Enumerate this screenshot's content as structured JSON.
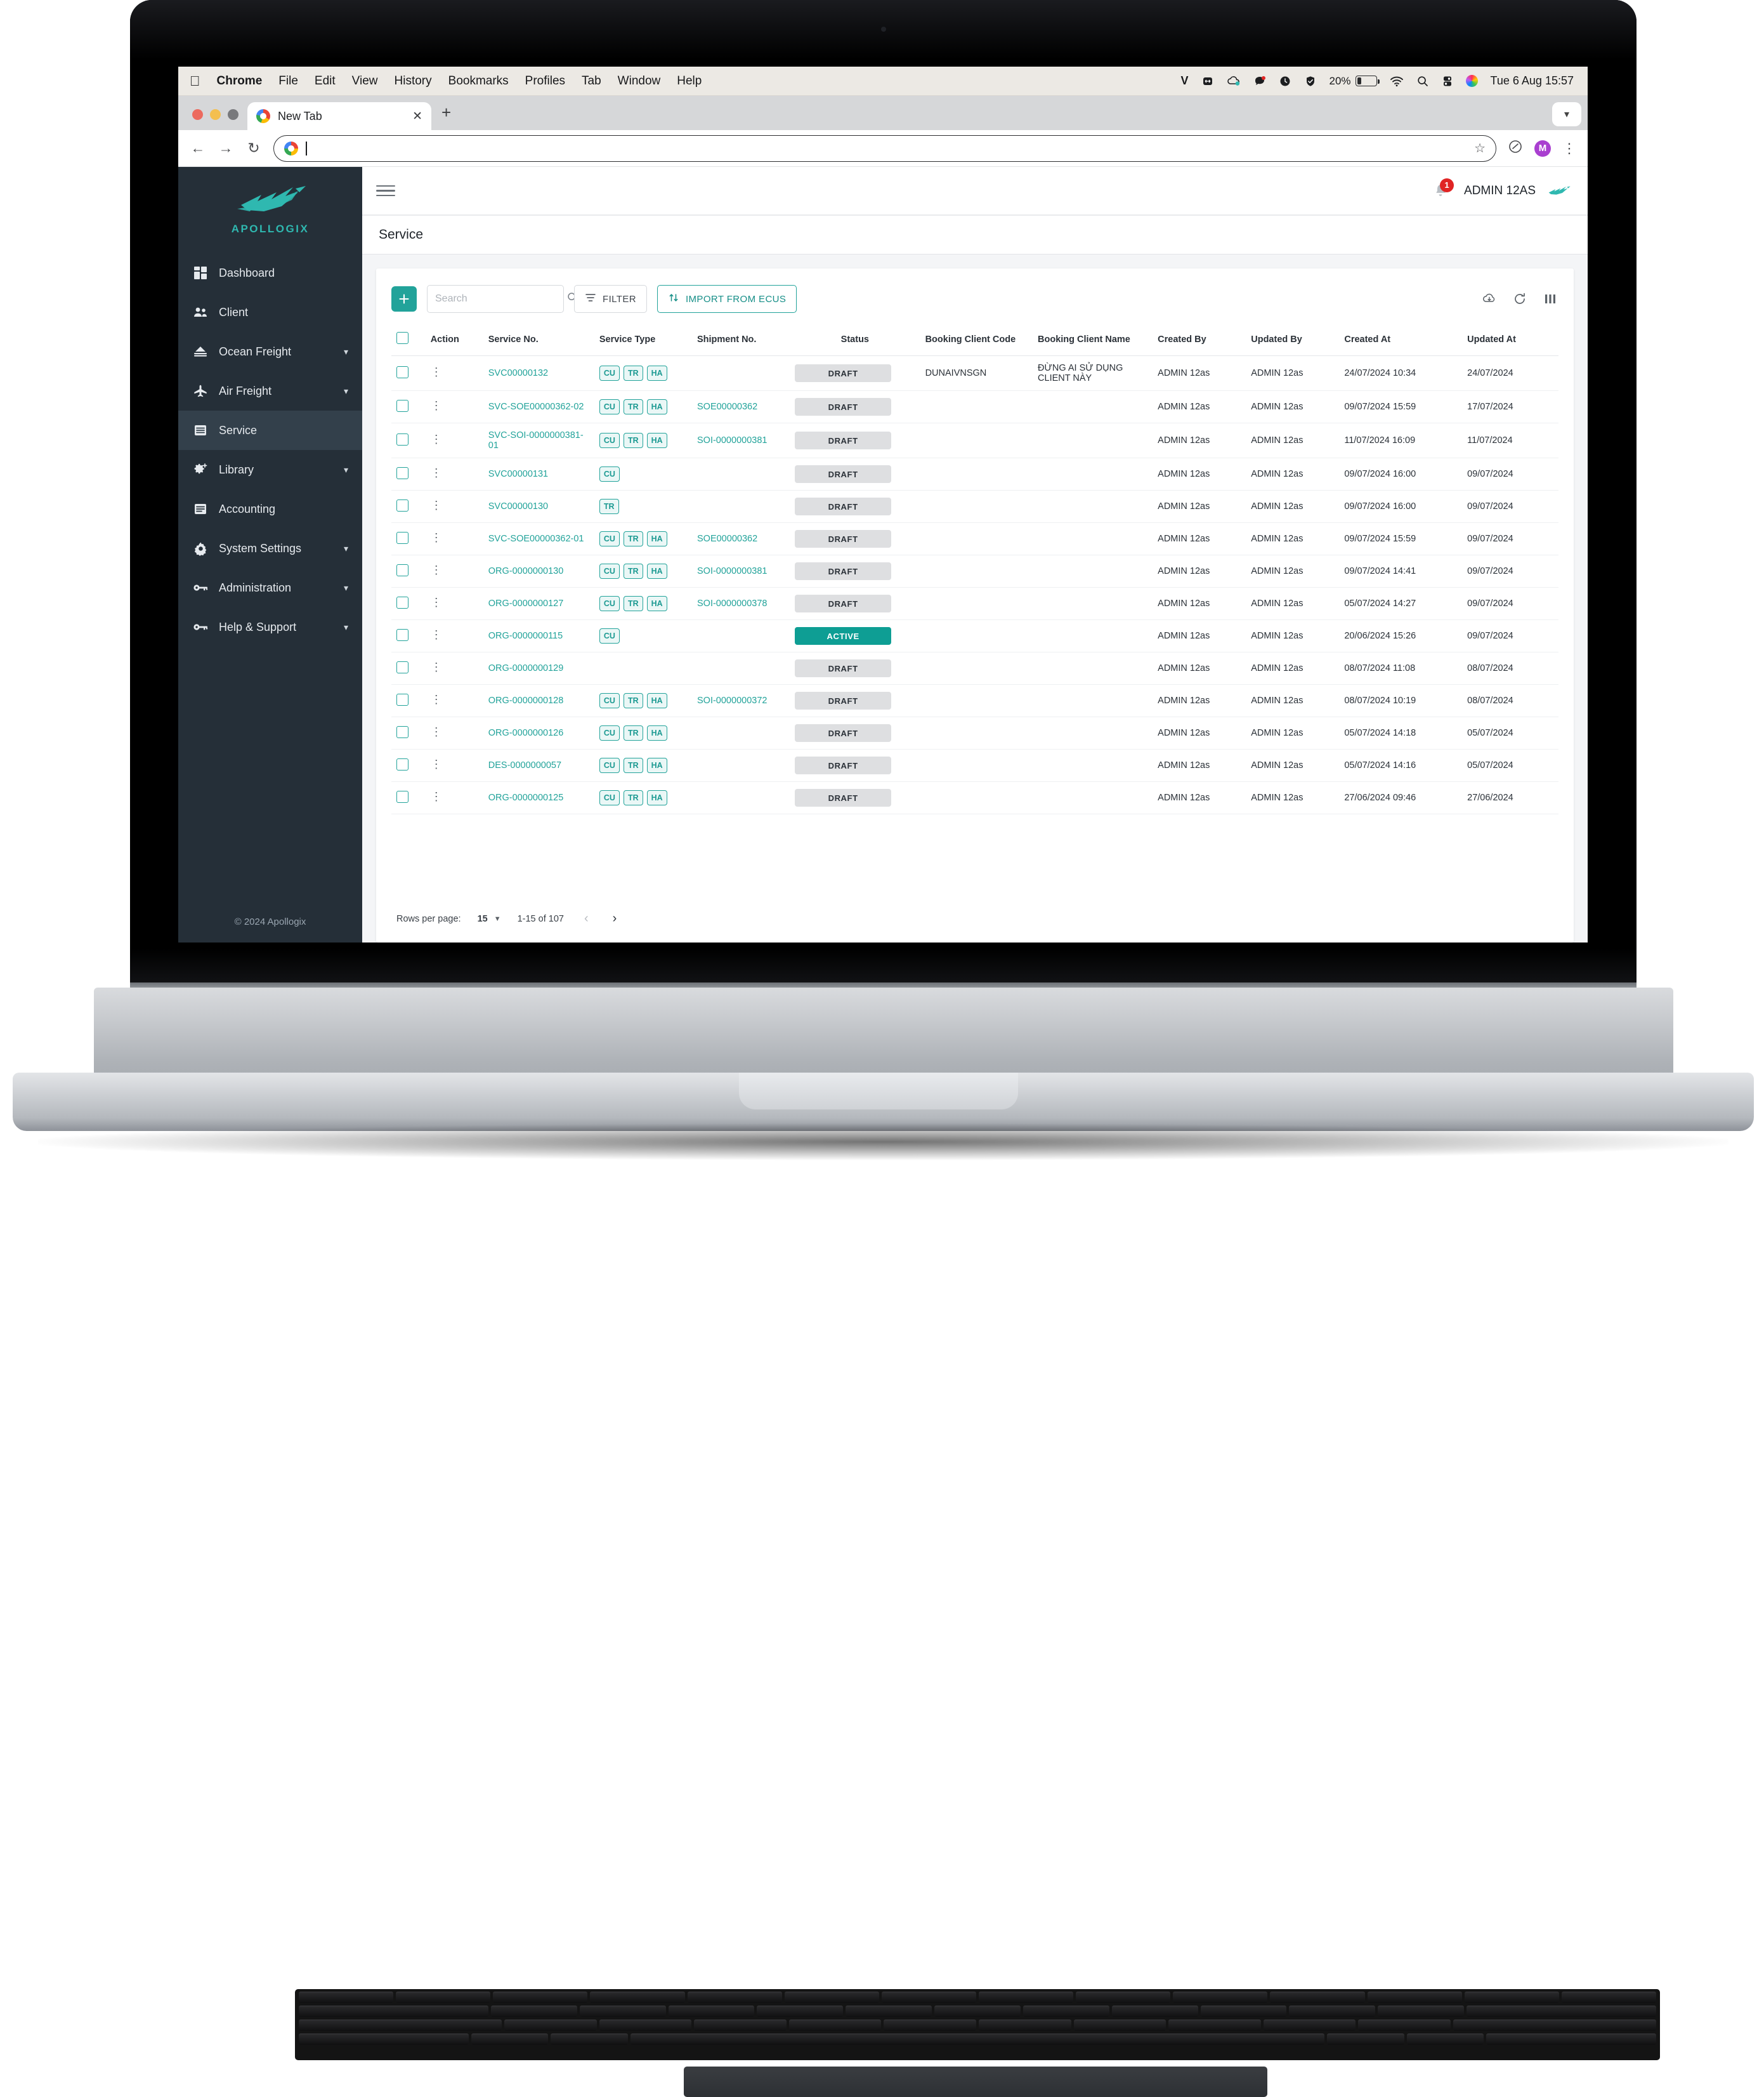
{
  "menubar": {
    "apple_logo": "apple-logo",
    "items": [
      "Chrome",
      "File",
      "Edit",
      "View",
      "History",
      "Bookmarks",
      "Profiles",
      "Tab",
      "Window",
      "Help"
    ],
    "right_icons": [
      "v-icon",
      "expand-icon",
      "cloud-sync-icon",
      "messages-icon",
      "clock-icon",
      "shield-check-icon"
    ],
    "battery_percent": "20%",
    "wifi_icon": "wifi-icon",
    "search_icon": "search-icon",
    "control_center_icon": "control-center-icon",
    "siri_icon": "siri-icon",
    "clock": "Tue 6 Aug  15:57"
  },
  "browser": {
    "tab_title": "New Tab",
    "tab_close_icon": "close-icon",
    "new_tab_icon": "plus-icon",
    "tabstrip_menu_icon": "chevron-down-icon",
    "back_icon": "arrow-left-icon",
    "forward_icon": "arrow-right-icon",
    "reload_icon": "reload-icon",
    "omnibox_value": "",
    "omnibox_placeholder": "",
    "bookmark_icon": "star-icon",
    "extension_icon": "extension-icon",
    "profile_initial": "M",
    "menu_icon": "kebab-menu-icon"
  },
  "sidebar": {
    "brand_name": "APOLLOGIX",
    "brand_logo": "bird-logo",
    "items": [
      {
        "label": "Dashboard",
        "icon": "dashboard-icon",
        "expandable": false,
        "active": false
      },
      {
        "label": "Client",
        "icon": "people-icon",
        "expandable": false,
        "active": false
      },
      {
        "label": "Ocean Freight",
        "icon": "ship-icon",
        "expandable": true,
        "active": false
      },
      {
        "label": "Air Freight",
        "icon": "plane-icon",
        "expandable": true,
        "active": false
      },
      {
        "label": "Service",
        "icon": "list-icon",
        "expandable": false,
        "active": true
      },
      {
        "label": "Library",
        "icon": "gear-plus-icon",
        "expandable": true,
        "active": false
      },
      {
        "label": "Accounting",
        "icon": "ledger-icon",
        "expandable": false,
        "active": false
      },
      {
        "label": "System Settings",
        "icon": "gear-icon",
        "expandable": true,
        "active": false
      },
      {
        "label": "Administration",
        "icon": "key-icon",
        "expandable": true,
        "active": false
      },
      {
        "label": "Help & Support",
        "icon": "key-icon",
        "expandable": true,
        "active": false
      }
    ],
    "footer": "© 2024 Apollogix"
  },
  "topbar": {
    "menu_icon": "hamburger-icon",
    "notification_icon": "bell-icon",
    "notification_count": "1",
    "user_name": "ADMIN 12AS",
    "user_logo": "bird-logo"
  },
  "page": {
    "title": "Service"
  },
  "toolbar": {
    "add_label": "+",
    "search_placeholder": "Search",
    "search_value": "",
    "search_icon": "search-icon",
    "filter_label": "FILTER",
    "filter_icon": "filter-icon",
    "import_label": "IMPORT FROM ECUS",
    "import_icon": "sort-updown-icon",
    "download_icon": "cloud-download-icon",
    "refresh_icon": "refresh-icon",
    "columns_icon": "columns-icon"
  },
  "table": {
    "headers": [
      "",
      "Action",
      "Service No.",
      "Service Type",
      "Shipment No.",
      "Status",
      "Booking Client Code",
      "Booking Client Name",
      "Created By",
      "Updated By",
      "Created At",
      "Updated At"
    ],
    "rows": [
      {
        "service_no": "SVC00000132",
        "types": [
          "CU",
          "TR",
          "HA"
        ],
        "shipment_no": "",
        "status": "DRAFT",
        "status_kind": "draft",
        "booking_client_code": "DUNAIVNSGN",
        "booking_client_name": "ĐỪNG AI SỬ DỤNG CLIENT NÀY",
        "created_by": "ADMIN 12as",
        "updated_by": "ADMIN 12as",
        "created_at": "24/07/2024 10:34",
        "updated_at": "24/07/2024"
      },
      {
        "service_no": "SVC-SOE00000362-02",
        "types": [
          "CU",
          "TR",
          "HA"
        ],
        "shipment_no": "SOE00000362",
        "status": "DRAFT",
        "status_kind": "draft",
        "booking_client_code": "",
        "booking_client_name": "",
        "created_by": "ADMIN 12as",
        "updated_by": "ADMIN 12as",
        "created_at": "09/07/2024 15:59",
        "updated_at": "17/07/2024"
      },
      {
        "service_no": "SVC-SOI-0000000381-01",
        "types": [
          "CU",
          "TR",
          "HA"
        ],
        "shipment_no": "SOI-0000000381",
        "status": "DRAFT",
        "status_kind": "draft",
        "booking_client_code": "",
        "booking_client_name": "",
        "created_by": "ADMIN 12as",
        "updated_by": "ADMIN 12as",
        "created_at": "11/07/2024 16:09",
        "updated_at": "11/07/2024"
      },
      {
        "service_no": "SVC00000131",
        "types": [
          "CU"
        ],
        "shipment_no": "",
        "status": "DRAFT",
        "status_kind": "draft",
        "booking_client_code": "",
        "booking_client_name": "",
        "created_by": "ADMIN 12as",
        "updated_by": "ADMIN 12as",
        "created_at": "09/07/2024 16:00",
        "updated_at": "09/07/2024"
      },
      {
        "service_no": "SVC00000130",
        "types": [
          "TR"
        ],
        "shipment_no": "",
        "status": "DRAFT",
        "status_kind": "draft",
        "booking_client_code": "",
        "booking_client_name": "",
        "created_by": "ADMIN 12as",
        "updated_by": "ADMIN 12as",
        "created_at": "09/07/2024 16:00",
        "updated_at": "09/07/2024"
      },
      {
        "service_no": "SVC-SOE00000362-01",
        "types": [
          "CU",
          "TR",
          "HA"
        ],
        "shipment_no": "SOE00000362",
        "status": "DRAFT",
        "status_kind": "draft",
        "booking_client_code": "",
        "booking_client_name": "",
        "created_by": "ADMIN 12as",
        "updated_by": "ADMIN 12as",
        "created_at": "09/07/2024 15:59",
        "updated_at": "09/07/2024"
      },
      {
        "service_no": "ORG-0000000130",
        "types": [
          "CU",
          "TR",
          "HA"
        ],
        "shipment_no": "SOI-0000000381",
        "status": "DRAFT",
        "status_kind": "draft",
        "booking_client_code": "",
        "booking_client_name": "",
        "created_by": "ADMIN 12as",
        "updated_by": "ADMIN 12as",
        "created_at": "09/07/2024 14:41",
        "updated_at": "09/07/2024"
      },
      {
        "service_no": "ORG-0000000127",
        "types": [
          "CU",
          "TR",
          "HA"
        ],
        "shipment_no": "SOI-0000000378",
        "status": "DRAFT",
        "status_kind": "draft",
        "booking_client_code": "",
        "booking_client_name": "",
        "created_by": "ADMIN 12as",
        "updated_by": "ADMIN 12as",
        "created_at": "05/07/2024 14:27",
        "updated_at": "09/07/2024"
      },
      {
        "service_no": "ORG-0000000115",
        "types": [
          "CU"
        ],
        "shipment_no": "",
        "status": "ACTIVE",
        "status_kind": "active",
        "booking_client_code": "",
        "booking_client_name": "",
        "created_by": "ADMIN 12as",
        "updated_by": "ADMIN 12as",
        "created_at": "20/06/2024 15:26",
        "updated_at": "09/07/2024"
      },
      {
        "service_no": "ORG-0000000129",
        "types": [],
        "shipment_no": "",
        "status": "DRAFT",
        "status_kind": "draft",
        "booking_client_code": "",
        "booking_client_name": "",
        "created_by": "ADMIN 12as",
        "updated_by": "ADMIN 12as",
        "created_at": "08/07/2024 11:08",
        "updated_at": "08/07/2024"
      },
      {
        "service_no": "ORG-0000000128",
        "types": [
          "CU",
          "TR",
          "HA"
        ],
        "shipment_no": "SOI-0000000372",
        "status": "DRAFT",
        "status_kind": "draft",
        "booking_client_code": "",
        "booking_client_name": "",
        "created_by": "ADMIN 12as",
        "updated_by": "ADMIN 12as",
        "created_at": "08/07/2024 10:19",
        "updated_at": "08/07/2024"
      },
      {
        "service_no": "ORG-0000000126",
        "types": [
          "CU",
          "TR",
          "HA"
        ],
        "shipment_no": "",
        "status": "DRAFT",
        "status_kind": "draft",
        "booking_client_code": "",
        "booking_client_name": "",
        "created_by": "ADMIN 12as",
        "updated_by": "ADMIN 12as",
        "created_at": "05/07/2024 14:18",
        "updated_at": "05/07/2024"
      },
      {
        "service_no": "DES-0000000057",
        "types": [
          "CU",
          "TR",
          "HA"
        ],
        "shipment_no": "",
        "status": "DRAFT",
        "status_kind": "draft",
        "booking_client_code": "",
        "booking_client_name": "",
        "created_by": "ADMIN 12as",
        "updated_by": "ADMIN 12as",
        "created_at": "05/07/2024 14:16",
        "updated_at": "05/07/2024"
      },
      {
        "service_no": "ORG-0000000125",
        "types": [
          "CU",
          "TR",
          "HA"
        ],
        "shipment_no": "",
        "status": "DRAFT",
        "status_kind": "draft",
        "booking_client_code": "",
        "booking_client_name": "",
        "created_by": "ADMIN 12as",
        "updated_by": "ADMIN 12as",
        "created_at": "27/06/2024 09:46",
        "updated_at": "27/06/2024"
      }
    ]
  },
  "pagination": {
    "rows_per_page_label": "Rows per page:",
    "rows_per_page_value": "15",
    "range_label": "1-15 of 107",
    "prev_icon": "chevron-left-icon",
    "next_icon": "chevron-right-icon"
  },
  "colors": {
    "accent_teal": "#22a39a",
    "status_active": "#0e9e94",
    "status_draft_bg": "#dedfe1",
    "sidebar_bg": "#252f38",
    "sidebar_active": "#33404b",
    "badge_red": "#e02424"
  }
}
